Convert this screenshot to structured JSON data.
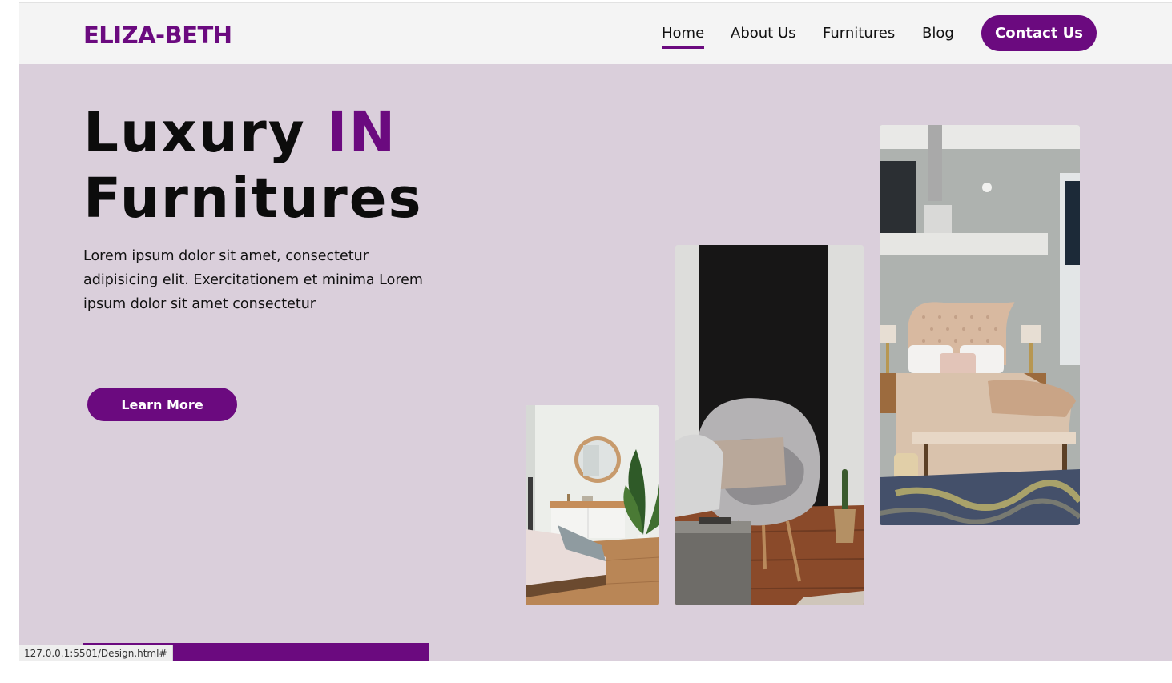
{
  "header": {
    "logo": "ELIZA-BETH",
    "nav": [
      {
        "label": "Home",
        "active": true
      },
      {
        "label": "About Us",
        "active": false
      },
      {
        "label": "Furnitures",
        "active": false
      },
      {
        "label": "Blog",
        "active": false
      }
    ],
    "contact_label": "Contact Us"
  },
  "hero": {
    "title_part1": "Luxury",
    "title_accent": "IN",
    "title_line2": "Furnitures",
    "description": "Lorem ipsum dolor sit amet, consectetur adipisicing elit. Exercitationem et minima Lorem ipsum dolor sit amet consectetur",
    "learn_more_label": "Learn More"
  },
  "gallery": [
    {
      "subject": "bedroom with round mirror and plant"
    },
    {
      "subject": "grey lounge chair with cushion"
    },
    {
      "subject": "bedroom with tufted headboard"
    }
  ],
  "status_bar": {
    "url": "127.0.0.1:5501/Design.html#"
  },
  "colors": {
    "brand": "#6b0a7f",
    "background": "#dacfdb",
    "header_bg": "#f4f4f4"
  }
}
